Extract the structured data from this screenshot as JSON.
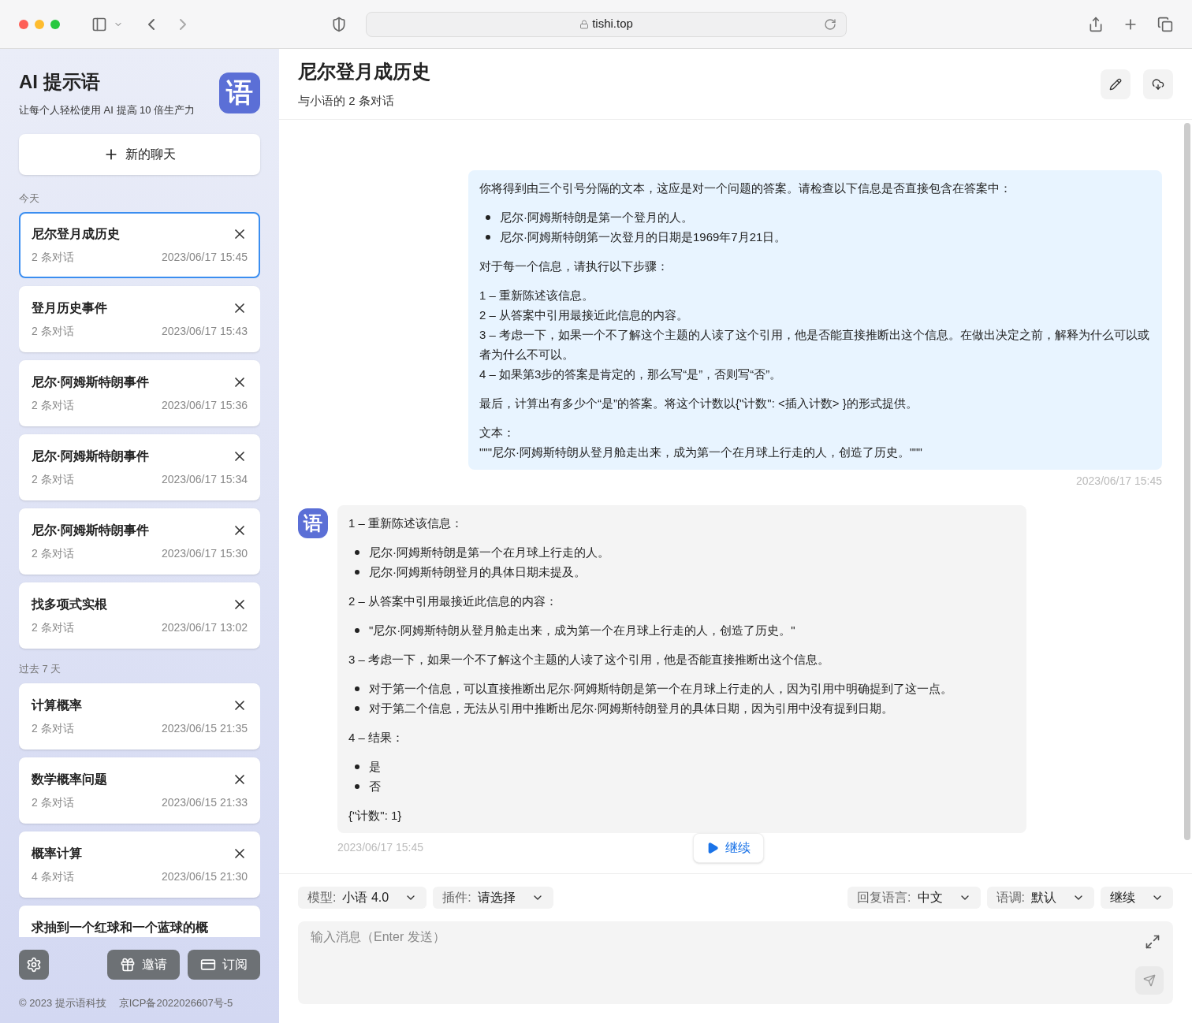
{
  "browser": {
    "url": "tishi.top"
  },
  "sidebar": {
    "title": "AI 提示语",
    "subtitle": "让每个人轻松使用 AI 提高 10 倍生产力",
    "logo_char": "语",
    "new_chat": "新的聊天",
    "groups": [
      {
        "label": "今天",
        "items": [
          {
            "title": "尼尔登月成历史",
            "count": "2 条对话",
            "time": "2023/06/17 15:45",
            "selected": true
          },
          {
            "title": "登月历史事件",
            "count": "2 条对话",
            "time": "2023/06/17 15:43",
            "selected": false
          },
          {
            "title": "尼尔·阿姆斯特朗事件",
            "count": "2 条对话",
            "time": "2023/06/17 15:36",
            "selected": false
          },
          {
            "title": "尼尔·阿姆斯特朗事件",
            "count": "2 条对话",
            "time": "2023/06/17 15:34",
            "selected": false
          },
          {
            "title": "尼尔·阿姆斯特朗事件",
            "count": "2 条对话",
            "time": "2023/06/17 15:30",
            "selected": false
          },
          {
            "title": "找多项式实根",
            "count": "2 条对话",
            "time": "2023/06/17 13:02",
            "selected": false
          }
        ]
      },
      {
        "label": "过去 7 天",
        "items": [
          {
            "title": "计算概率",
            "count": "2 条对话",
            "time": "2023/06/15 21:35",
            "selected": false
          },
          {
            "title": "数学概率问题",
            "count": "2 条对话",
            "time": "2023/06/15 21:33",
            "selected": false
          },
          {
            "title": "概率计算",
            "count": "4 条对话",
            "time": "2023/06/15 21:30",
            "selected": false
          },
          {
            "title": "求抽到一个红球和一个蓝球的概",
            "selected": false
          }
        ]
      }
    ],
    "buttons": [
      "邀请",
      "订阅"
    ],
    "footer": [
      "© 2023 提示语科技",
      "京ICP备2022026607号-5"
    ]
  },
  "chat": {
    "title": "尼尔登月成历史",
    "subtitle": "与小语的 2 条对话",
    "messages": [
      {
        "kind": "user",
        "time": "2023/06/17 15:45",
        "blocks": [
          {
            "kind": "paragraph",
            "lines": [
              "你将得到由三个引号分隔的文本，这应是对一个问题的答案。请检查以下信息是否直接包含在答案中："
            ]
          },
          {
            "kind": "bullets",
            "lines": [
              "尼尔·阿姆斯特朗是第一个登月的人。",
              "尼尔·阿姆斯特朗第一次登月的日期是1969年7月21日。"
            ]
          },
          {
            "kind": "paragraph",
            "lines": [
              "对于每一个信息，请执行以下步骤："
            ]
          },
          {
            "kind": "paragraph",
            "lines": [
              "1 – 重新陈述该信息。",
              "2 – 从答案中引用最接近此信息的内容。",
              "3 – 考虑一下，如果一个不了解这个主题的人读了这个引用，他是否能直接推断出这个信息。在做出决定之前，解释为什么可以或者为什么不可以。",
              "4 – 如果第3步的答案是肯定的，那么写“是”，否则写“否”。"
            ]
          },
          {
            "kind": "paragraph",
            "lines": [
              "最后，计算出有多少个“是”的答案。将这个计数以{\"计数\": <插入计数> }的形式提供。"
            ]
          },
          {
            "kind": "paragraph",
            "lines": [
              "文本：",
              "\"\"\"尼尔·阿姆斯特朗从登月舱走出来，成为第一个在月球上行走的人，创造了历史。\"\"\""
            ]
          }
        ]
      },
      {
        "kind": "assistant",
        "avatar_char": "语",
        "time": "2023/06/17 15:45",
        "blocks": [
          {
            "kind": "paragraph",
            "lines": [
              "1 – 重新陈述该信息："
            ]
          },
          {
            "kind": "bullets",
            "lines": [
              "尼尔·阿姆斯特朗是第一个在月球上行走的人。",
              "尼尔·阿姆斯特朗登月的具体日期未提及。"
            ]
          },
          {
            "kind": "paragraph",
            "lines": [
              "2 – 从答案中引用最接近此信息的内容："
            ]
          },
          {
            "kind": "bullets",
            "lines": [
              "\"尼尔·阿姆斯特朗从登月舱走出来，成为第一个在月球上行走的人，创造了历史。\""
            ]
          },
          {
            "kind": "paragraph",
            "lines": [
              "3 – 考虑一下，如果一个不了解这个主题的人读了这个引用，他是否能直接推断出这个信息。"
            ]
          },
          {
            "kind": "bullets",
            "lines": [
              "对于第一个信息，可以直接推断出尼尔·阿姆斯特朗是第一个在月球上行走的人，因为引用中明确提到了这一点。",
              "对于第二个信息，无法从引用中推断出尼尔·阿姆斯特朗登月的具体日期，因为引用中没有提到日期。"
            ]
          },
          {
            "kind": "paragraph",
            "lines": [
              "4 – 结果："
            ]
          },
          {
            "kind": "bullets",
            "lines": [
              "是",
              "否"
            ]
          },
          {
            "kind": "paragraph",
            "lines": [
              "{\"计数\": 1}"
            ]
          }
        ]
      }
    ],
    "continue_button": "继续"
  },
  "composer": {
    "selects": [
      {
        "label": "模型:",
        "value": "小语 4.0"
      },
      {
        "label": "插件:",
        "value": "请选择"
      },
      {
        "label": "回复语言:",
        "value": "中文"
      },
      {
        "label": "语调:",
        "value": "默认"
      },
      {
        "value": "继续"
      }
    ],
    "placeholder": "输入消息（Enter 发送）"
  }
}
